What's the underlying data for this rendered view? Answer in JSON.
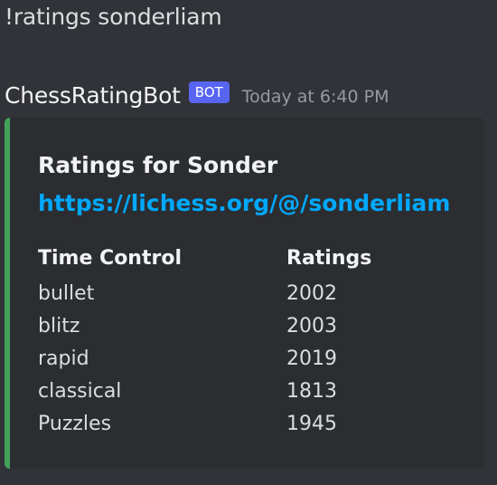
{
  "user_message": "!ratings sonderliam",
  "bot": {
    "name": "ChessRatingBot",
    "badge": "BOT",
    "timestamp": "Today at 6:40 PM"
  },
  "embed": {
    "accent_color": "#43a25a",
    "title": "Ratings for Sonder",
    "link": "https://lichess.org/@/sonderliam",
    "fields": {
      "left_header": "Time Control",
      "right_header": "Ratings",
      "rows": [
        {
          "time_control": "bullet",
          "rating": "2002"
        },
        {
          "time_control": "blitz",
          "rating": "2003"
        },
        {
          "time_control": "rapid",
          "rating": "2019"
        },
        {
          "time_control": "classical",
          "rating": "1813"
        },
        {
          "time_control": "Puzzles",
          "rating": "1945"
        }
      ]
    }
  }
}
